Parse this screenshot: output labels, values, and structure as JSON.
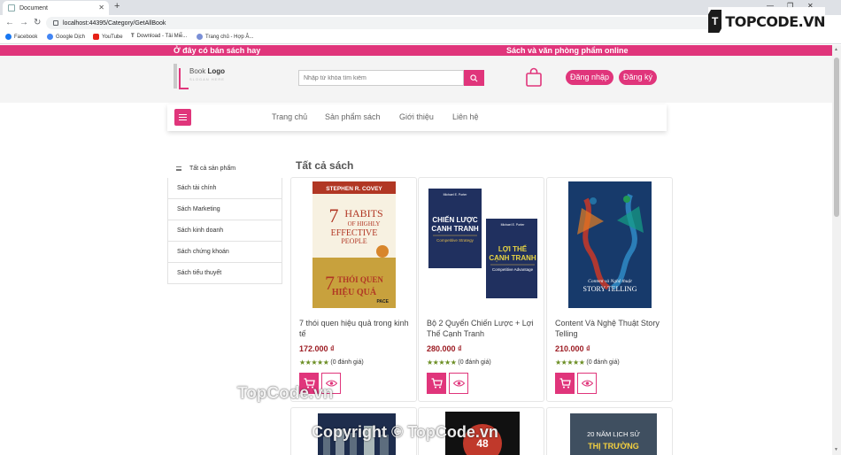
{
  "browser": {
    "tab_title": "Document",
    "url": "localhost:44395/Category/GetAllBook",
    "bookmarks": [
      "Facebook",
      "Google Dịch",
      "YouTube",
      "Download - Tải Miễ...",
      "Trang chủ - Hợp Â..."
    ]
  },
  "topcode_logo": "TOPCODE.VN",
  "promo": {
    "left": "Ở đây có bán sách hay",
    "right": "Sách và văn phòng phẩm online"
  },
  "logo": {
    "name_1": "Book",
    "name_2": "Logo",
    "sub": "SLOGAN HERE"
  },
  "search": {
    "placeholder": "Nhập từ khóa tìm kiếm"
  },
  "auth": {
    "login": "Đăng nhập",
    "register": "Đăng ký"
  },
  "nav": [
    "Trang chủ",
    "Sản phẩm sách",
    "Giới thiệu",
    "Liên hệ"
  ],
  "sidebar": {
    "header": "Tất cả sản phẩm",
    "items": [
      "Sách tài chính",
      "Sách Marketing",
      "Sách kinh doanh",
      "Sách chứng khoán",
      "Sách tiểu thuyết"
    ]
  },
  "section_title": "Tất cả sách",
  "products": [
    {
      "title": "7 thói quen hiệu quả trong kinh tế",
      "price": "172.000 ₫",
      "reviews": "(0 đánh giá)",
      "cover": {
        "author": "STEPHEN R. COVEY",
        "t1": "7",
        "t2": "HABITS",
        "t3": "OF HIGHLY",
        "t4": "EFFECTIVE",
        "t5": "PEOPLE",
        "t6": "THÓI QUEN",
        "t7": "HIỆU QUẢ",
        "pub": "PACE"
      }
    },
    {
      "title": "Bộ 2 Quyển Chiến Lược + Lợi Thế Cạnh Tranh",
      "price": "280.000 ₫",
      "reviews": "(0 đánh giá)",
      "cover": {
        "author": "Michael E. Porter",
        "a1": "CHIẾN LƯỢC",
        "a2": "CẠNH TRANH",
        "a3": "Competitive Strategy",
        "b1": "LỢI THẾ",
        "b2": "CẠNH TRANH",
        "b3": "Competitive Advantage"
      }
    },
    {
      "title": "Content Và Nghệ Thuật Story Telling",
      "price": "210.000 ₫",
      "reviews": "(0 đánh giá)",
      "cover": {
        "t1": "Content và Nghệ thuật",
        "t2": "STORY TELLING"
      }
    }
  ],
  "bottom_row": {
    "book6_line1": "20 NĂM LỊCH SỬ",
    "book6_line2": "THỊ TRƯỜNG",
    "book5_num": "48"
  },
  "watermarks": {
    "top": "TopCode.vn",
    "bottom": "Copyright © TopCode.vn"
  },
  "colors": {
    "accent": "#e0357b",
    "price": "#9c1b22",
    "stars": "#6b8e23"
  }
}
